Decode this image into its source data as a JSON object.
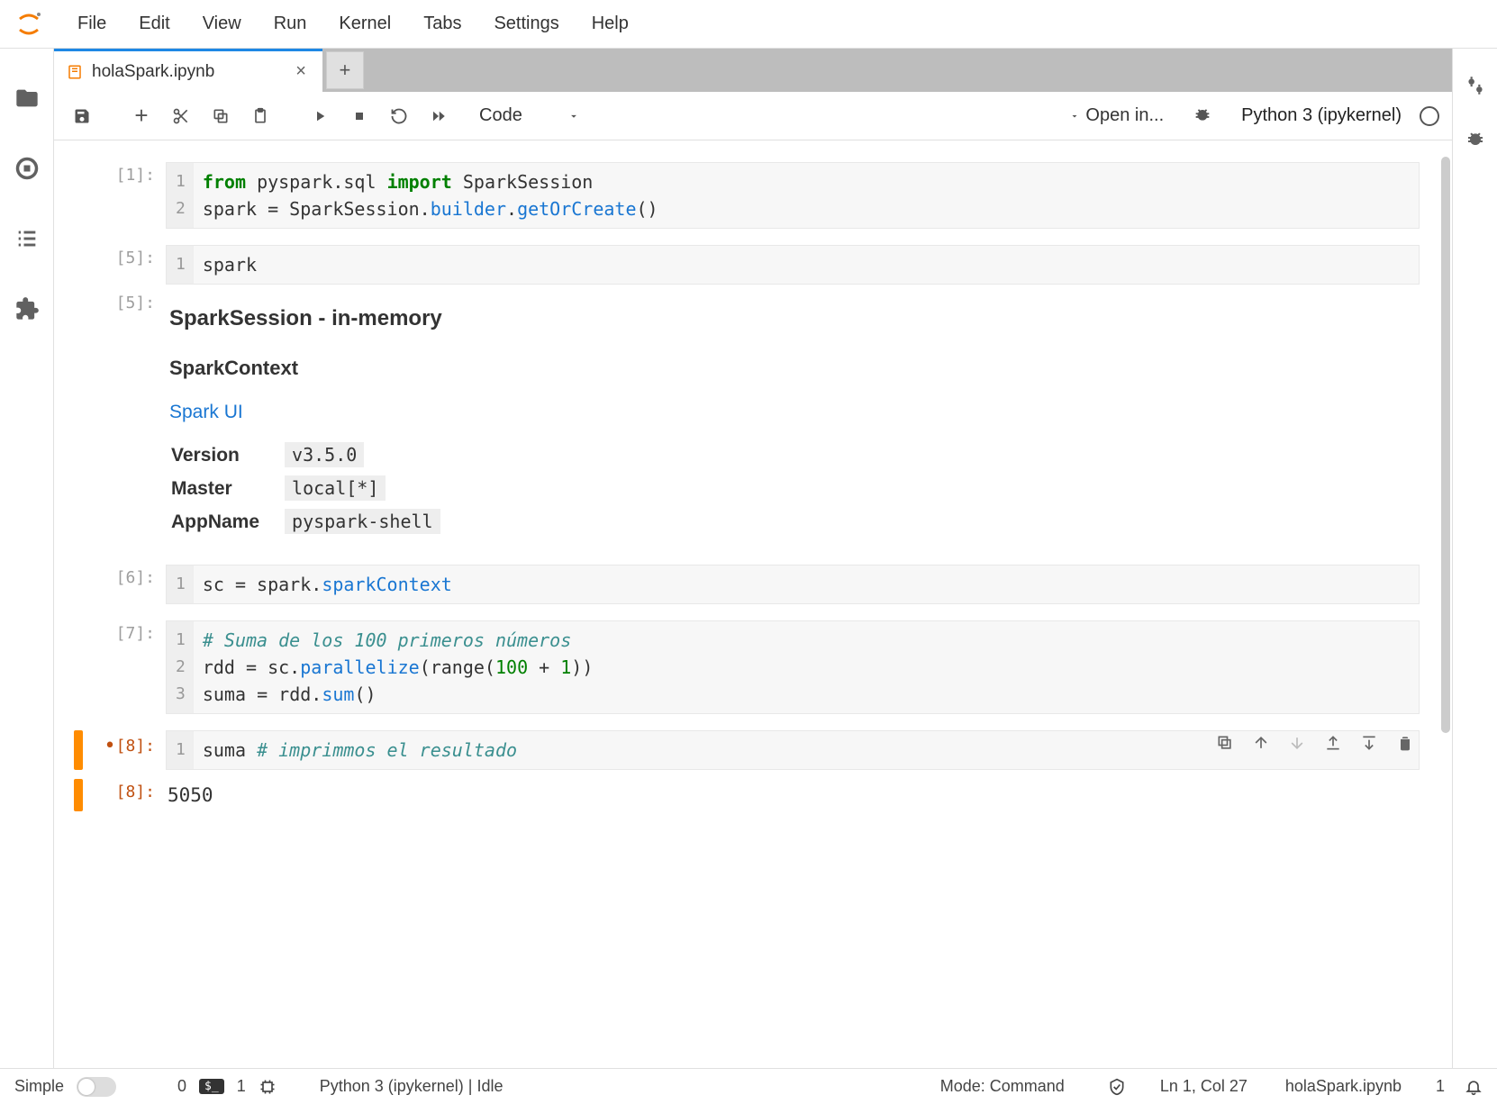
{
  "menu": [
    "File",
    "Edit",
    "View",
    "Run",
    "Kernel",
    "Tabs",
    "Settings",
    "Help"
  ],
  "tab": {
    "title": "holaSpark.ipynb"
  },
  "toolbar": {
    "celltype": "Code",
    "openin": "Open in...",
    "kernel": "Python 3 (ipykernel)"
  },
  "cells": {
    "c1": {
      "prompt": "[1]:",
      "gutter": [
        "1",
        "2"
      ],
      "tok": {
        "from": "from",
        "import": "import",
        "mod": "pyspark.sql",
        "cls": "SparkSession",
        "l2a": "spark ",
        "eq": "=",
        "l2b": " SparkSession.",
        "b": "builder",
        "dot": ".",
        "g": "getOrCreate",
        "par": "()"
      }
    },
    "c2": {
      "prompt": "[5]:",
      "gutter": [
        "1"
      ],
      "code": "spark"
    },
    "out2": {
      "prompt": "[5]:",
      "h3": "SparkSession - in-memory",
      "h4": "SparkContext",
      "link": "Spark UI",
      "rows": [
        {
          "k": "Version",
          "v": "v3.5.0"
        },
        {
          "k": "Master",
          "v": "local[*]"
        },
        {
          "k": "AppName",
          "v": "pyspark-shell"
        }
      ]
    },
    "c3": {
      "prompt": "[6]:",
      "gutter": [
        "1"
      ],
      "tok": {
        "a": "sc ",
        "eq": "=",
        "b": " spark.",
        "m": "sparkContext"
      }
    },
    "c4": {
      "prompt": "[7]:",
      "gutter": [
        "1",
        "2",
        "3"
      ],
      "l1": "# Suma de los 100 primeros números",
      "l2": {
        "a": "rdd ",
        "eq": "=",
        "b": " sc.",
        "m": "parallelize",
        "c": "(range(",
        "n": "100",
        "d": " + ",
        "n2": "1",
        "e": "))"
      },
      "l3": {
        "a": "suma ",
        "eq": "=",
        "b": " rdd.",
        "m": "sum",
        "c": "()"
      }
    },
    "c5": {
      "prompt": "[8]:",
      "gutter": [
        "1"
      ],
      "tok": {
        "a": "suma ",
        "c": "# imprimmos el resultado"
      }
    },
    "out5": {
      "prompt": "[8]:",
      "text": "5050"
    }
  },
  "status": {
    "simple": "Simple",
    "zero": "0",
    "one": "1",
    "kernel": "Python 3 (ipykernel) | Idle",
    "mode": "Mode: Command",
    "lncol": "Ln 1, Col 27",
    "file": "holaSpark.ipynb",
    "count": "1"
  }
}
